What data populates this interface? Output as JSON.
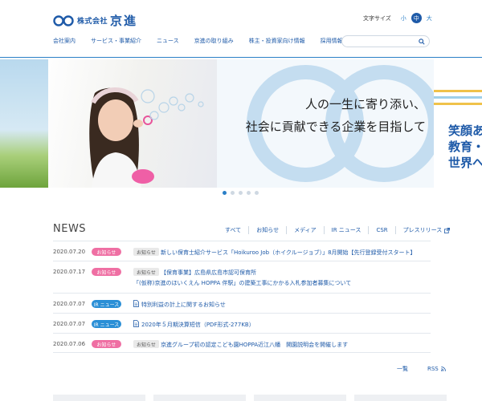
{
  "header": {
    "logo_small": "株式会社",
    "logo_big": "京進",
    "font_size_label": "文字サイズ",
    "font_sizes": [
      "小",
      "中",
      "大"
    ],
    "nav": [
      "会社案内",
      "サービス・事業紹介",
      "ニュース",
      "京進の取り組み",
      "株主・投資家向け情報",
      "採用情報"
    ],
    "search_placeholder": ""
  },
  "hero": {
    "copy_line1": "人の一生に寄り添い、",
    "copy_line2": "社会に貢献できる企業を目指して",
    "peek_lines": [
      "笑顔あ",
      "教育・",
      "世界へ"
    ],
    "slide_count": 5,
    "active_slide": 0
  },
  "news": {
    "title": "NEWS",
    "filters": [
      "すべて",
      "お知らせ",
      "メディア",
      "IR ニュース",
      "CSR",
      "プレスリリース"
    ],
    "items": [
      {
        "date": "2020.07.20",
        "badge": "お知らせ",
        "badge_color": "pink",
        "category": "お知らせ",
        "text": "新しい保育士紹介サービス「Hoikuroo Job（ホイクルージョブ）」8月開始【先行登録受付スタート】",
        "text2": ""
      },
      {
        "date": "2020.07.17",
        "badge": "お知らせ",
        "badge_color": "pink",
        "category": "お知らせ",
        "text": "【保育事業】広島県広島市認可保育所",
        "text2": "「(仮称)京進のほいくえん HOPPA 伴駅」の建築工事にかかる入札参加者募集について"
      },
      {
        "date": "2020.07.07",
        "badge": "IR ニュース",
        "badge_color": "blue",
        "category": "",
        "text": "特別利益の計上に関するお知らせ",
        "text2": ""
      },
      {
        "date": "2020.07.07",
        "badge": "IR ニュース",
        "badge_color": "blue",
        "category": "",
        "text": "2020年５月期決算短信（PDF形式-277KB）",
        "text2": ""
      },
      {
        "date": "2020.07.06",
        "badge": "お知らせ",
        "badge_color": "pink",
        "category": "お知らせ",
        "text": "京進グループ初の認定こども園HOPPA近江八幡　開園説明会を開催します",
        "text2": ""
      }
    ],
    "more_label": "一覧",
    "rss_label": "RSS"
  },
  "colors": {
    "brand_blue": "#1e5aa8",
    "accent_pink": "#ef6fa3",
    "accent_blue": "#2a8fd6"
  }
}
